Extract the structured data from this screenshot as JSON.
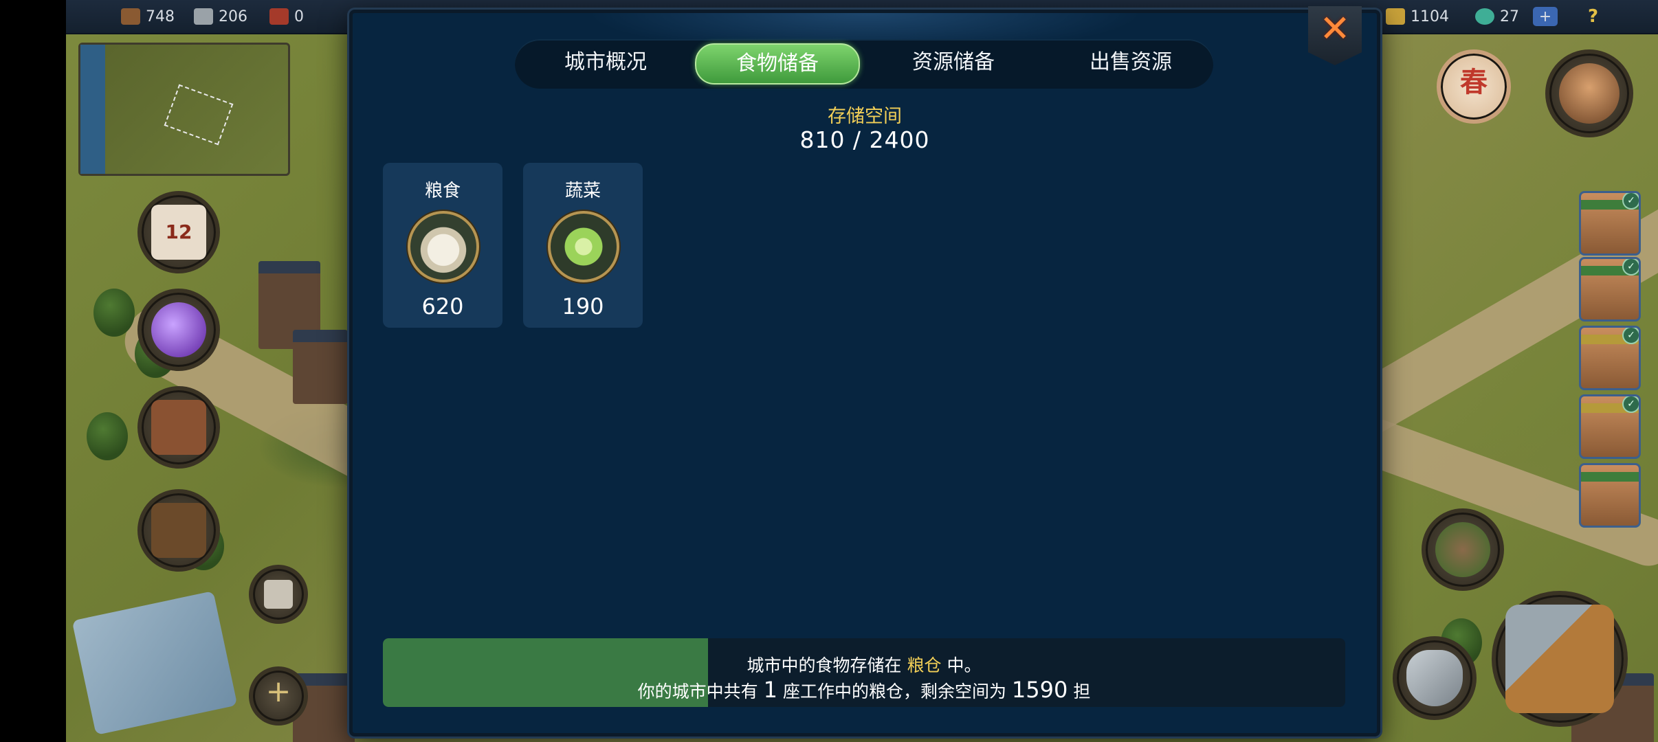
{
  "topbar": {
    "resources_left": [
      {
        "name": "wood-icon",
        "value": "748"
      },
      {
        "name": "stone-icon",
        "value": "206"
      },
      {
        "name": "brick-icon",
        "value": "0"
      }
    ],
    "resources_right": [
      {
        "name": "gold-icon",
        "value": "1104"
      },
      {
        "name": "gem-icon",
        "value": "27"
      }
    ],
    "add_label": "+",
    "help_label": "?"
  },
  "hud": {
    "calendar_day": "12",
    "season_label": "春",
    "build_add_label": "+"
  },
  "modal": {
    "tabs": [
      {
        "label": "城市概况",
        "active": false
      },
      {
        "label": "食物储备",
        "active": true
      },
      {
        "label": "资源储备",
        "active": false
      },
      {
        "label": "出售资源",
        "active": false
      }
    ],
    "close_icon": "close-icon",
    "storage_label": "存储空间",
    "storage_value": "810 / 2400",
    "storage_fraction": 0.3375,
    "items": [
      {
        "name": "粮食",
        "quantity": "620",
        "icon": "grain-sack-icon"
      },
      {
        "name": "蔬菜",
        "quantity": "190",
        "icon": "cabbage-icon"
      }
    ],
    "info": {
      "line1_pre": "城市中的食物存储在",
      "line1_highlight": "粮仓",
      "line1_post": "中。",
      "line2_pre": "你的城市中共有",
      "line2_count": "1",
      "line2_mid": "座工作中的粮仓，剩余空间为",
      "line2_space": "1590",
      "line2_unit": "担"
    },
    "colors": {
      "accent_green": "#4fae46",
      "highlight_yellow": "#f2cf57",
      "panel_blue": "#072540",
      "close_orange": "#ff8a3a"
    }
  }
}
